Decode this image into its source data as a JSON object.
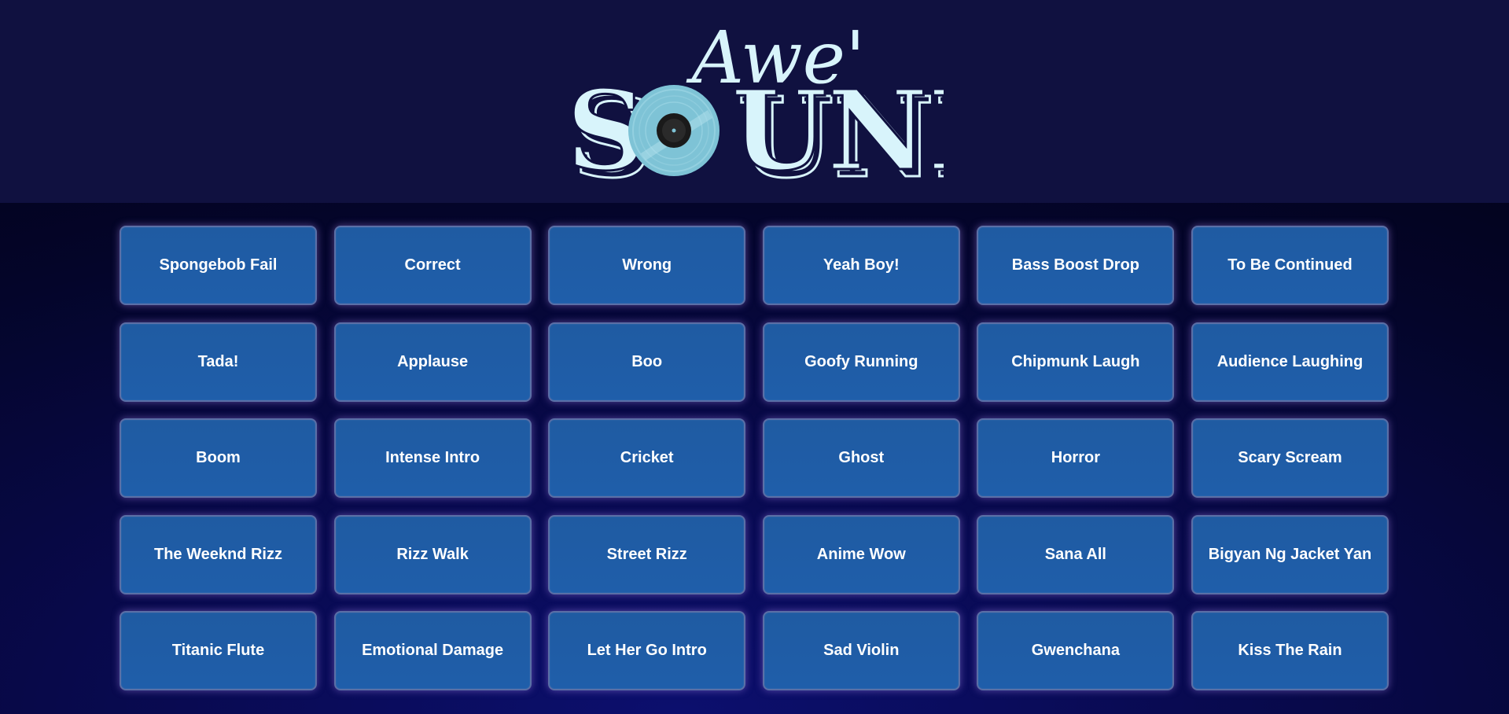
{
  "logo": {
    "line1": "Awe'",
    "line2_left": "S",
    "line2_right": "UND"
  },
  "sounds": [
    "Spongebob Fail",
    "Correct",
    "Wrong",
    "Yeah Boy!",
    "Bass Boost Drop",
    "To Be Continued",
    "Tada!",
    "Applause",
    "Boo",
    "Goofy Running",
    "Chipmunk Laugh",
    "Audience Laughing",
    "Boom",
    "Intense Intro",
    "Cricket",
    "Ghost",
    "Horror",
    "Scary Scream",
    "The Weeknd Rizz",
    "Rizz Walk",
    "Street Rizz",
    "Anime Wow",
    "Sana All",
    "Bigyan Ng Jacket Yan",
    "Titanic Flute",
    "Emotional Damage",
    "Let Her Go Intro",
    "Sad Violin",
    "Gwenchana",
    "Kiss The Rain"
  ],
  "colors": {
    "header_bg": "#101140",
    "button_bg": "#1f5ca6",
    "logo_text": "#d8f4fb",
    "vinyl": "#7ec3d6"
  }
}
